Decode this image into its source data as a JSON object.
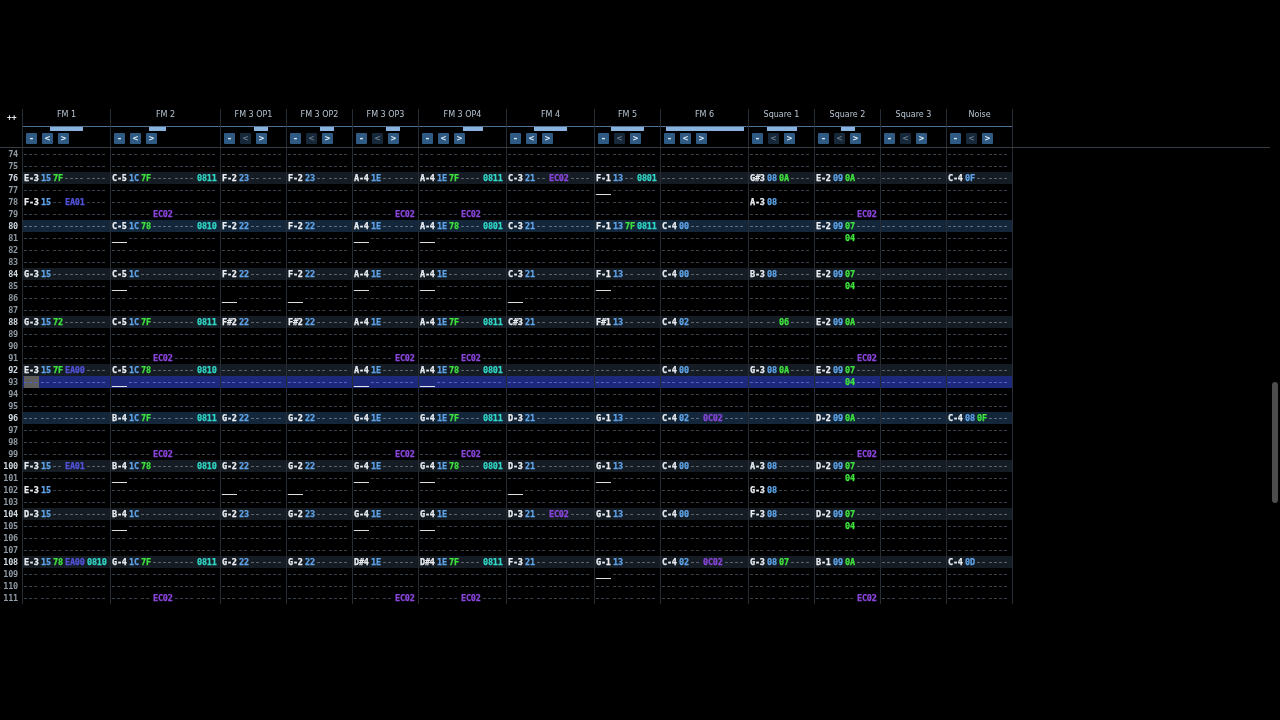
{
  "pattern": {
    "corner_button": "++",
    "channels": [
      {
        "name": "FM 1",
        "cursor": true,
        "meter": [
          {
            "level": 0.39
          },
          {
            "level": 0.39
          }
        ],
        "buttons": [
          {
            "label": "-",
            "disabled": false
          },
          {
            "label": "<",
            "disabled": false
          },
          {
            "label": ">",
            "disabled": false
          }
        ],
        "slots": [
          {
            "kind": "note"
          },
          {
            "kind": "instrument"
          },
          {
            "kind": "volume"
          },
          {
            "kind": "effect"
          },
          {
            "kind": "effect"
          }
        ]
      },
      {
        "name": "FM 2",
        "cursor": false,
        "meter": [
          {
            "level": 0.3
          },
          {
            "level": 0
          }
        ],
        "buttons": [
          {
            "label": "-",
            "disabled": false
          },
          {
            "label": "<",
            "disabled": false
          },
          {
            "label": ">",
            "disabled": false
          }
        ],
        "slots": [
          {
            "kind": "note"
          },
          {
            "kind": "instrument"
          },
          {
            "kind": "volume"
          },
          {
            "kind": "effect"
          },
          {
            "kind": "effect"
          },
          {
            "kind": "effect"
          }
        ]
      },
      {
        "name": "FM 3 OP1",
        "cursor": false,
        "meter": [
          {
            "level": 0
          },
          {
            "level": 0.45
          }
        ],
        "buttons": [
          {
            "label": "-",
            "disabled": false
          },
          {
            "label": "<",
            "disabled": true
          },
          {
            "label": ">",
            "disabled": false
          }
        ],
        "slots": [
          {
            "kind": "note"
          },
          {
            "kind": "instrument"
          },
          {
            "kind": "volume"
          },
          {
            "kind": "effect"
          }
        ]
      },
      {
        "name": "FM 3 OP2",
        "cursor": false,
        "meter": [
          {
            "level": 0
          },
          {
            "level": 0.45
          }
        ],
        "buttons": [
          {
            "label": "-",
            "disabled": false
          },
          {
            "label": "<",
            "disabled": true
          },
          {
            "label": ">",
            "disabled": false
          }
        ],
        "slots": [
          {
            "kind": "note"
          },
          {
            "kind": "instrument"
          },
          {
            "kind": "volume"
          },
          {
            "kind": "effect"
          }
        ]
      },
      {
        "name": "FM 3 OP3",
        "cursor": false,
        "meter": [
          {
            "level": 0
          },
          {
            "level": 0.45
          }
        ],
        "buttons": [
          {
            "label": "-",
            "disabled": false
          },
          {
            "label": "<",
            "disabled": true
          },
          {
            "label": ">",
            "disabled": false
          }
        ],
        "slots": [
          {
            "kind": "note"
          },
          {
            "kind": "instrument"
          },
          {
            "kind": "volume"
          },
          {
            "kind": "effect"
          }
        ]
      },
      {
        "name": "FM 3 OP4",
        "cursor": false,
        "meter": [
          {
            "level": 0
          },
          {
            "level": 0.46
          }
        ],
        "buttons": [
          {
            "label": "-",
            "disabled": false
          },
          {
            "label": "<",
            "disabled": false
          },
          {
            "label": ">",
            "disabled": false
          }
        ],
        "slots": [
          {
            "kind": "note"
          },
          {
            "kind": "instrument"
          },
          {
            "kind": "volume"
          },
          {
            "kind": "effect"
          },
          {
            "kind": "effect"
          }
        ]
      },
      {
        "name": "FM 4",
        "cursor": false,
        "meter": [
          {
            "level": 0.39
          },
          {
            "level": 0.39
          }
        ],
        "buttons": [
          {
            "label": "-",
            "disabled": false
          },
          {
            "label": "<",
            "disabled": false
          },
          {
            "label": ">",
            "disabled": false
          }
        ],
        "slots": [
          {
            "kind": "note"
          },
          {
            "kind": "instrument"
          },
          {
            "kind": "volume"
          },
          {
            "kind": "effect"
          },
          {
            "kind": "effect"
          }
        ]
      },
      {
        "name": "FM 5",
        "cursor": false,
        "meter": [
          {
            "level": 0.52
          },
          {
            "level": 0.52
          }
        ],
        "buttons": [
          {
            "label": "-",
            "disabled": false
          },
          {
            "label": "<",
            "disabled": true
          },
          {
            "label": ">",
            "disabled": false
          }
        ],
        "slots": [
          {
            "kind": "note"
          },
          {
            "kind": "instrument"
          },
          {
            "kind": "volume"
          },
          {
            "kind": "effect"
          }
        ]
      },
      {
        "name": "FM 6",
        "cursor": false,
        "meter": [
          {
            "level": 0.89
          },
          {
            "level": 0.91
          }
        ],
        "buttons": [
          {
            "label": "-",
            "disabled": false
          },
          {
            "label": "<",
            "disabled": false
          },
          {
            "label": ">",
            "disabled": false
          }
        ],
        "slots": [
          {
            "kind": "note"
          },
          {
            "kind": "instrument"
          },
          {
            "kind": "volume"
          },
          {
            "kind": "effect"
          },
          {
            "kind": "effect"
          }
        ]
      },
      {
        "name": "Square 1",
        "cursor": false,
        "meter": [
          {
            "level": 0.45
          },
          {
            "level": 0.48
          }
        ],
        "buttons": [
          {
            "label": "-",
            "disabled": false
          },
          {
            "label": "<",
            "disabled": true
          },
          {
            "label": ">",
            "disabled": false
          }
        ],
        "slots": [
          {
            "kind": "note"
          },
          {
            "kind": "instrument"
          },
          {
            "kind": "volume"
          },
          {
            "kind": "effect"
          }
        ]
      },
      {
        "name": "Square 2",
        "cursor": false,
        "meter": [
          {
            "level": 0.21
          },
          {
            "level": 0.24
          }
        ],
        "buttons": [
          {
            "label": "-",
            "disabled": false
          },
          {
            "label": "<",
            "disabled": true
          },
          {
            "label": ">",
            "disabled": false
          }
        ],
        "slots": [
          {
            "kind": "note"
          },
          {
            "kind": "instrument"
          },
          {
            "kind": "volume"
          },
          {
            "kind": "effect"
          }
        ]
      },
      {
        "name": "Square 3",
        "cursor": false,
        "meter": [
          {
            "level": 0
          },
          {
            "level": 0
          }
        ],
        "buttons": [
          {
            "label": "-",
            "disabled": false
          },
          {
            "label": "<",
            "disabled": true
          },
          {
            "label": ">",
            "disabled": false
          }
        ],
        "slots": [
          {
            "kind": "note"
          },
          {
            "kind": "instrument"
          },
          {
            "kind": "volume"
          },
          {
            "kind": "effect"
          }
        ]
      },
      {
        "name": "Noise",
        "cursor": false,
        "meter": [
          {
            "level": 0
          },
          {
            "level": 0
          }
        ],
        "buttons": [
          {
            "label": "-",
            "disabled": false
          },
          {
            "label": "<",
            "disabled": true
          },
          {
            "label": ">",
            "disabled": false
          }
        ],
        "slots": [
          {
            "kind": "note"
          },
          {
            "kind": "instrument"
          },
          {
            "kind": "volume"
          },
          {
            "kind": "effect"
          }
        ]
      }
    ],
    "rows": [
      {
        "number": "74",
        "beat": false,
        "bar": false,
        "selected": false,
        "cells": [
          null,
          null,
          null,
          null,
          null,
          null,
          null,
          null,
          null,
          null,
          null,
          null,
          null
        ]
      },
      {
        "number": "75",
        "beat": false,
        "bar": false,
        "selected": false,
        "cells": [
          null,
          null,
          null,
          null,
          null,
          null,
          null,
          null,
          null,
          null,
          null,
          null,
          null
        ]
      },
      {
        "number": "76",
        "beat": true,
        "bar": false,
        "selected": false,
        "cells": [
          [
            "E-3",
            "15",
            "7F",
            null,
            null
          ],
          [
            "C-5",
            "1C",
            "7F",
            null,
            null,
            {
              "code": "0811",
              "kind": "panning"
            }
          ],
          [
            "F-2",
            "23",
            null,
            null
          ],
          [
            "F-2",
            "23",
            null,
            null
          ],
          [
            "A-4",
            "1E",
            null,
            null
          ],
          [
            "A-4",
            "1E",
            "7F",
            null,
            {
              "code": "0811",
              "kind": "panning"
            }
          ],
          [
            "C-3",
            "21",
            null,
            {
              "code": "EC02",
              "kind": "time"
            },
            null
          ],
          [
            "F-1",
            "13",
            null,
            {
              "code": "0801",
              "kind": "panning"
            }
          ],
          null,
          [
            "G#3",
            "08",
            "0A",
            null
          ],
          [
            "E-2",
            "09",
            "0A",
            null
          ],
          null,
          [
            "C-4",
            "0F",
            null,
            null
          ]
        ]
      },
      {
        "number": "77",
        "beat": false,
        "bar": false,
        "selected": false,
        "cells": [
          null,
          null,
          null,
          null,
          null,
          null,
          null,
          [
            "___",
            null,
            null,
            null
          ],
          null,
          null,
          null,
          null,
          null
        ]
      },
      {
        "number": "78",
        "beat": false,
        "bar": false,
        "selected": false,
        "cells": [
          [
            "F-3",
            "15",
            null,
            {
              "code": "EA01",
              "kind": "misc"
            },
            null
          ],
          null,
          null,
          null,
          null,
          null,
          null,
          null,
          null,
          [
            "A-3",
            "08",
            null,
            null
          ],
          null,
          null,
          null
        ]
      },
      {
        "number": "79",
        "beat": false,
        "bar": false,
        "selected": false,
        "cells": [
          null,
          [
            null,
            null,
            null,
            {
              "code": "EC02",
              "kind": "time"
            },
            null,
            null
          ],
          null,
          null,
          [
            null,
            null,
            null,
            {
              "code": "EC02",
              "kind": "time"
            }
          ],
          [
            null,
            null,
            null,
            {
              "code": "EC02",
              "kind": "time"
            },
            null
          ],
          null,
          null,
          null,
          null,
          [
            null,
            null,
            null,
            {
              "code": "EC02",
              "kind": "time"
            }
          ],
          null,
          null
        ]
      },
      {
        "number": "80",
        "beat": true,
        "bar": true,
        "selected": false,
        "cells": [
          null,
          [
            "C-5",
            "1C",
            "78",
            null,
            null,
            {
              "code": "0810",
              "kind": "panning"
            }
          ],
          [
            "F-2",
            "22",
            null,
            null
          ],
          [
            "F-2",
            "22",
            null,
            null
          ],
          [
            "A-4",
            "1E",
            null,
            null
          ],
          [
            "A-4",
            "1E",
            "78",
            null,
            {
              "code": "0801",
              "kind": "panning"
            }
          ],
          [
            "C-3",
            "21",
            null,
            null,
            null
          ],
          [
            "F-1",
            "13",
            "7F",
            {
              "code": "0811",
              "kind": "panning"
            }
          ],
          [
            "C-4",
            "00",
            null,
            null,
            null
          ],
          null,
          [
            "E-2",
            "09",
            "07",
            null
          ],
          null,
          null
        ]
      },
      {
        "number": "81",
        "beat": false,
        "bar": false,
        "selected": false,
        "cells": [
          null,
          [
            "___",
            null,
            null,
            null,
            null,
            null
          ],
          null,
          null,
          [
            "___",
            null,
            null,
            null
          ],
          [
            "___",
            null,
            null,
            null,
            null
          ],
          null,
          null,
          null,
          null,
          [
            null,
            null,
            "04",
            null
          ],
          null,
          null
        ]
      },
      {
        "number": "82",
        "beat": false,
        "bar": false,
        "selected": false,
        "cells": [
          null,
          null,
          null,
          null,
          null,
          null,
          null,
          null,
          null,
          null,
          null,
          null,
          null
        ]
      },
      {
        "number": "83",
        "beat": false,
        "bar": false,
        "selected": false,
        "cells": [
          null,
          null,
          null,
          null,
          null,
          null,
          null,
          null,
          null,
          null,
          null,
          null,
          null
        ]
      },
      {
        "number": "84",
        "beat": true,
        "bar": false,
        "selected": false,
        "cells": [
          [
            "G-3",
            "15",
            null,
            null,
            null
          ],
          [
            "C-5",
            "1C",
            null,
            null,
            null,
            null
          ],
          [
            "F-2",
            "22",
            null,
            null
          ],
          [
            "F-2",
            "22",
            null,
            null
          ],
          [
            "A-4",
            "1E",
            null,
            null
          ],
          [
            "A-4",
            "1E",
            null,
            null,
            null
          ],
          [
            "C-3",
            "21",
            null,
            null,
            null
          ],
          [
            "F-1",
            "13",
            null,
            null
          ],
          [
            "C-4",
            "00",
            null,
            null,
            null
          ],
          [
            "B-3",
            "08",
            null,
            null
          ],
          [
            "E-2",
            "09",
            "07",
            null
          ],
          null,
          null
        ]
      },
      {
        "number": "85",
        "beat": false,
        "bar": false,
        "selected": false,
        "cells": [
          null,
          [
            "___",
            null,
            null,
            null,
            null,
            null
          ],
          null,
          null,
          [
            "___",
            null,
            null,
            null
          ],
          [
            "___",
            null,
            null,
            null,
            null
          ],
          null,
          [
            "___",
            null,
            null,
            null
          ],
          null,
          null,
          [
            null,
            null,
            "04",
            null
          ],
          null,
          null
        ]
      },
      {
        "number": "86",
        "beat": false,
        "bar": false,
        "selected": false,
        "cells": [
          null,
          null,
          [
            "___",
            null,
            null,
            null
          ],
          [
            "___",
            null,
            null,
            null
          ],
          null,
          null,
          [
            "___",
            null,
            null,
            null,
            null
          ],
          null,
          null,
          null,
          null,
          null,
          null
        ]
      },
      {
        "number": "87",
        "beat": false,
        "bar": false,
        "selected": false,
        "cells": [
          null,
          null,
          null,
          null,
          null,
          null,
          null,
          null,
          null,
          null,
          null,
          null,
          null
        ]
      },
      {
        "number": "88",
        "beat": true,
        "bar": false,
        "selected": false,
        "cells": [
          [
            "G-3",
            "15",
            "72",
            null,
            null
          ],
          [
            "C-5",
            "1C",
            "7F",
            null,
            null,
            {
              "code": "0811",
              "kind": "panning"
            }
          ],
          [
            "F#2",
            "22",
            null,
            null
          ],
          [
            "F#2",
            "22",
            null,
            null
          ],
          [
            "A-4",
            "1E",
            null,
            null
          ],
          [
            "A-4",
            "1E",
            "7F",
            null,
            {
              "code": "0811",
              "kind": "panning"
            }
          ],
          [
            "C#3",
            "21",
            null,
            null,
            null
          ],
          [
            "F#1",
            "13",
            null,
            null
          ],
          [
            "C-4",
            "02",
            null,
            null,
            null
          ],
          [
            null,
            null,
            "06",
            null
          ],
          [
            "E-2",
            "09",
            "0A",
            null
          ],
          null,
          null
        ]
      },
      {
        "number": "89",
        "beat": false,
        "bar": false,
        "selected": false,
        "cells": [
          null,
          null,
          null,
          null,
          null,
          null,
          null,
          null,
          null,
          null,
          null,
          null,
          null
        ]
      },
      {
        "number": "90",
        "beat": false,
        "bar": false,
        "selected": false,
        "cells": [
          null,
          null,
          null,
          null,
          null,
          null,
          null,
          null,
          null,
          null,
          null,
          null,
          null
        ]
      },
      {
        "number": "91",
        "beat": false,
        "bar": false,
        "selected": false,
        "cells": [
          null,
          [
            null,
            null,
            null,
            {
              "code": "EC02",
              "kind": "time"
            },
            null,
            null
          ],
          null,
          null,
          [
            null,
            null,
            null,
            {
              "code": "EC02",
              "kind": "time"
            }
          ],
          [
            null,
            null,
            null,
            {
              "code": "EC02",
              "kind": "time"
            },
            null
          ],
          null,
          null,
          null,
          null,
          [
            null,
            null,
            null,
            {
              "code": "EC02",
              "kind": "time"
            }
          ],
          null,
          null
        ]
      },
      {
        "number": "92",
        "beat": true,
        "bar": false,
        "selected": false,
        "cells": [
          [
            "E-3",
            "15",
            "7F",
            {
              "code": "EA00",
              "kind": "misc"
            },
            null
          ],
          [
            "C-5",
            "1C",
            "78",
            null,
            null,
            {
              "code": "0810",
              "kind": "panning"
            }
          ],
          null,
          null,
          [
            "A-4",
            "1E",
            null,
            null
          ],
          [
            "A-4",
            "1E",
            "78",
            null,
            {
              "code": "0801",
              "kind": "panning"
            }
          ],
          null,
          null,
          [
            "C-4",
            "00",
            null,
            null,
            null
          ],
          [
            "G-3",
            "08",
            "0A",
            null
          ],
          [
            "E-2",
            "09",
            "07",
            null
          ],
          null,
          null
        ]
      },
      {
        "number": "93",
        "beat": false,
        "bar": false,
        "selected": true,
        "cells": [
          null,
          [
            "___",
            null,
            null,
            null,
            null,
            null
          ],
          null,
          null,
          [
            "___",
            null,
            null,
            null
          ],
          [
            "___",
            null,
            null,
            null,
            null
          ],
          null,
          null,
          null,
          null,
          [
            null,
            null,
            "04",
            null
          ],
          null,
          null
        ]
      },
      {
        "number": "94",
        "beat": false,
        "bar": false,
        "selected": false,
        "cells": [
          null,
          null,
          null,
          null,
          null,
          null,
          null,
          null,
          null,
          null,
          null,
          null,
          null
        ]
      },
      {
        "number": "95",
        "beat": false,
        "bar": false,
        "selected": false,
        "cells": [
          null,
          null,
          null,
          null,
          null,
          null,
          null,
          null,
          null,
          null,
          null,
          null,
          null
        ]
      },
      {
        "number": "96",
        "beat": true,
        "bar": true,
        "selected": false,
        "cells": [
          null,
          [
            "B-4",
            "1C",
            "7F",
            null,
            null,
            {
              "code": "0811",
              "kind": "panning"
            }
          ],
          [
            "G-2",
            "22",
            null,
            null
          ],
          [
            "G-2",
            "22",
            null,
            null
          ],
          [
            "G-4",
            "1E",
            null,
            null
          ],
          [
            "G-4",
            "1E",
            "7F",
            null,
            {
              "code": "0811",
              "kind": "panning"
            }
          ],
          [
            "D-3",
            "21",
            null,
            null,
            null
          ],
          [
            "G-1",
            "13",
            null,
            null
          ],
          [
            "C-4",
            "02",
            null,
            {
              "code": "0C02",
              "kind": "time"
            },
            null
          ],
          null,
          [
            "D-2",
            "09",
            "0A",
            null
          ],
          null,
          [
            "C-4",
            "08",
            "0F",
            null
          ]
        ]
      },
      {
        "number": "97",
        "beat": false,
        "bar": false,
        "selected": false,
        "cells": [
          null,
          null,
          null,
          null,
          null,
          null,
          null,
          null,
          null,
          null,
          null,
          null,
          null
        ]
      },
      {
        "number": "98",
        "beat": false,
        "bar": false,
        "selected": false,
        "cells": [
          null,
          null,
          null,
          null,
          null,
          null,
          null,
          null,
          null,
          null,
          null,
          null,
          null
        ]
      },
      {
        "number": "99",
        "beat": false,
        "bar": false,
        "selected": false,
        "cells": [
          null,
          [
            null,
            null,
            null,
            {
              "code": "EC02",
              "kind": "time"
            },
            null,
            null
          ],
          null,
          null,
          [
            null,
            null,
            null,
            {
              "code": "EC02",
              "kind": "time"
            }
          ],
          [
            null,
            null,
            null,
            {
              "code": "EC02",
              "kind": "time"
            },
            null
          ],
          null,
          null,
          null,
          null,
          [
            null,
            null,
            null,
            {
              "code": "EC02",
              "kind": "time"
            }
          ],
          null,
          null
        ]
      },
      {
        "number": "100",
        "beat": true,
        "bar": false,
        "selected": false,
        "cells": [
          [
            "F-3",
            "15",
            null,
            {
              "code": "EA01",
              "kind": "misc"
            },
            null
          ],
          [
            "B-4",
            "1C",
            "78",
            null,
            null,
            {
              "code": "0810",
              "kind": "panning"
            }
          ],
          [
            "G-2",
            "22",
            null,
            null
          ],
          [
            "G-2",
            "22",
            null,
            null
          ],
          [
            "G-4",
            "1E",
            null,
            null
          ],
          [
            "G-4",
            "1E",
            "78",
            null,
            {
              "code": "0801",
              "kind": "panning"
            }
          ],
          [
            "D-3",
            "21",
            null,
            null,
            null
          ],
          [
            "G-1",
            "13",
            null,
            null
          ],
          [
            "C-4",
            "00",
            null,
            null,
            null
          ],
          [
            "A-3",
            "08",
            null,
            null
          ],
          [
            "D-2",
            "09",
            "07",
            null
          ],
          null,
          null
        ]
      },
      {
        "number": "101",
        "beat": false,
        "bar": false,
        "selected": false,
        "cells": [
          null,
          [
            "___",
            null,
            null,
            null,
            null,
            null
          ],
          null,
          null,
          [
            "___",
            null,
            null,
            null
          ],
          [
            "___",
            null,
            null,
            null,
            null
          ],
          null,
          [
            "___",
            null,
            null,
            null
          ],
          null,
          null,
          [
            null,
            null,
            "04",
            null
          ],
          null,
          null
        ]
      },
      {
        "number": "102",
        "beat": false,
        "bar": false,
        "selected": false,
        "cells": [
          [
            "E-3",
            "15",
            null,
            null,
            null
          ],
          null,
          [
            "___",
            null,
            null,
            null
          ],
          [
            "___",
            null,
            null,
            null
          ],
          null,
          null,
          [
            "___",
            null,
            null,
            null,
            null
          ],
          null,
          null,
          [
            "G-3",
            "08",
            null,
            null
          ],
          null,
          null,
          null
        ]
      },
      {
        "number": "103",
        "beat": false,
        "bar": false,
        "selected": false,
        "cells": [
          null,
          null,
          null,
          null,
          null,
          null,
          null,
          null,
          null,
          null,
          null,
          null,
          null
        ]
      },
      {
        "number": "104",
        "beat": true,
        "bar": false,
        "selected": false,
        "cells": [
          [
            "D-3",
            "15",
            null,
            null,
            null
          ],
          [
            "B-4",
            "1C",
            null,
            null,
            null,
            null
          ],
          [
            "G-2",
            "23",
            null,
            null
          ],
          [
            "G-2",
            "23",
            null,
            null
          ],
          [
            "G-4",
            "1E",
            null,
            null
          ],
          [
            "G-4",
            "1E",
            null,
            null,
            null
          ],
          [
            "D-3",
            "21",
            null,
            {
              "code": "EC02",
              "kind": "time"
            },
            null
          ],
          [
            "G-1",
            "13",
            null,
            null
          ],
          [
            "C-4",
            "00",
            null,
            null,
            null
          ],
          [
            "F-3",
            "08",
            null,
            null
          ],
          [
            "D-2",
            "09",
            "07",
            null
          ],
          null,
          null
        ]
      },
      {
        "number": "105",
        "beat": false,
        "bar": false,
        "selected": false,
        "cells": [
          null,
          [
            "___",
            null,
            null,
            null,
            null,
            null
          ],
          null,
          null,
          [
            "___",
            null,
            null,
            null
          ],
          [
            "___",
            null,
            null,
            null,
            null
          ],
          null,
          null,
          null,
          null,
          [
            null,
            null,
            "04",
            null
          ],
          null,
          null
        ]
      },
      {
        "number": "106",
        "beat": false,
        "bar": false,
        "selected": false,
        "cells": [
          null,
          null,
          null,
          null,
          null,
          null,
          null,
          null,
          null,
          null,
          null,
          null,
          null
        ]
      },
      {
        "number": "107",
        "beat": false,
        "bar": false,
        "selected": false,
        "cells": [
          null,
          null,
          null,
          null,
          null,
          null,
          null,
          null,
          null,
          null,
          null,
          null,
          null
        ]
      },
      {
        "number": "108",
        "beat": true,
        "bar": false,
        "selected": false,
        "cells": [
          [
            "E-3",
            "15",
            "78",
            {
              "code": "EA00",
              "kind": "misc"
            },
            {
              "code": "0810",
              "kind": "panning"
            }
          ],
          [
            "G-4",
            "1C",
            "7F",
            null,
            null,
            {
              "code": "0811",
              "kind": "panning"
            }
          ],
          [
            "G-2",
            "22",
            null,
            null
          ],
          [
            "G-2",
            "22",
            null,
            null
          ],
          [
            "D#4",
            "1E",
            null,
            null
          ],
          [
            "D#4",
            "1E",
            "7F",
            null,
            {
              "code": "0811",
              "kind": "panning"
            }
          ],
          [
            "F-3",
            "21",
            null,
            null,
            null
          ],
          [
            "G-1",
            "13",
            null,
            null
          ],
          [
            "C-4",
            "02",
            null,
            {
              "code": "0C02",
              "kind": "time"
            },
            null
          ],
          [
            "G-3",
            "08",
            "07",
            null
          ],
          [
            "B-1",
            "09",
            "0A",
            null
          ],
          null,
          [
            "C-4",
            "0D",
            null,
            null
          ]
        ]
      },
      {
        "number": "109",
        "beat": false,
        "bar": false,
        "selected": false,
        "cells": [
          null,
          null,
          null,
          null,
          null,
          null,
          null,
          [
            "___",
            null,
            null,
            null
          ],
          null,
          null,
          null,
          null,
          null
        ]
      },
      {
        "number": "110",
        "beat": false,
        "bar": false,
        "selected": false,
        "cells": [
          null,
          null,
          null,
          null,
          null,
          null,
          null,
          null,
          null,
          null,
          null,
          null,
          null
        ]
      },
      {
        "number": "111",
        "beat": false,
        "bar": false,
        "selected": false,
        "cells": [
          null,
          [
            null,
            null,
            null,
            {
              "code": "EC02",
              "kind": "time"
            },
            null,
            null
          ],
          null,
          null,
          [
            null,
            null,
            null,
            {
              "code": "EC02",
              "kind": "time"
            }
          ],
          [
            null,
            null,
            null,
            {
              "code": "EC02",
              "kind": "time"
            },
            null
          ],
          null,
          null,
          null,
          null,
          [
            null,
            null,
            null,
            {
              "code": "EC02",
              "kind": "time"
            }
          ],
          null,
          null
        ]
      }
    ]
  }
}
